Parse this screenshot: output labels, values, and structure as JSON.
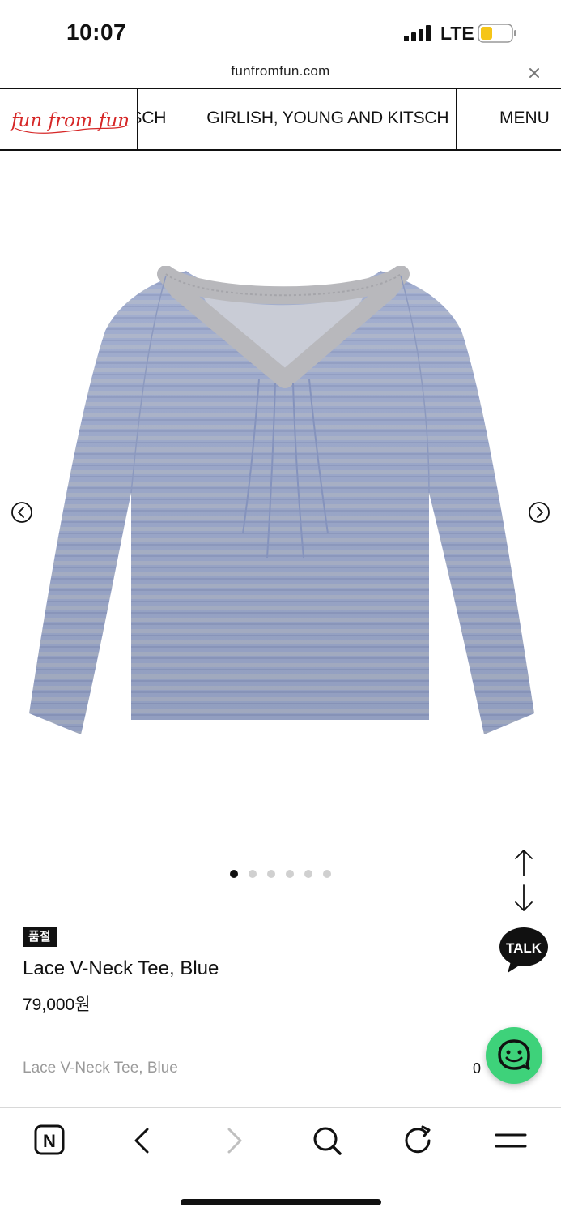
{
  "status_bar": {
    "time": "10:07",
    "network": "LTE",
    "battery_level": 0.4,
    "battery_color": "#f5c518"
  },
  "url_bar": {
    "domain": "funfromfun.com",
    "close_icon": "close-icon"
  },
  "header": {
    "logo_text": "fun from fun",
    "logo_color": "#d62828",
    "marquee_items": [
      "GIRLISH, YOUNG AND KITSCH",
      "GIRLISH, YOUNG AND KITSCH"
    ],
    "menu_label": "MENU"
  },
  "gallery": {
    "image_subject": "blue striped lace v-neck long sleeve tee",
    "slide_count": 6,
    "active_slide": 1,
    "prev_icon": "chevron-left-circle-icon",
    "next_icon": "chevron-right-circle-icon"
  },
  "product": {
    "badge": "품절",
    "name": "Lace V-Neck Tee, Blue",
    "price": "79,000원"
  },
  "cart": {
    "item_name": "Lace V-Neck Tee, Blue",
    "quantity": "0"
  },
  "floating": {
    "talk_label": "TALK",
    "chat_color": "#3ed27a"
  },
  "toolbar": {
    "home_label": "N",
    "icons": [
      "naver-home-icon",
      "back-icon",
      "forward-icon",
      "search-icon",
      "reload-icon",
      "menu-icon"
    ]
  }
}
